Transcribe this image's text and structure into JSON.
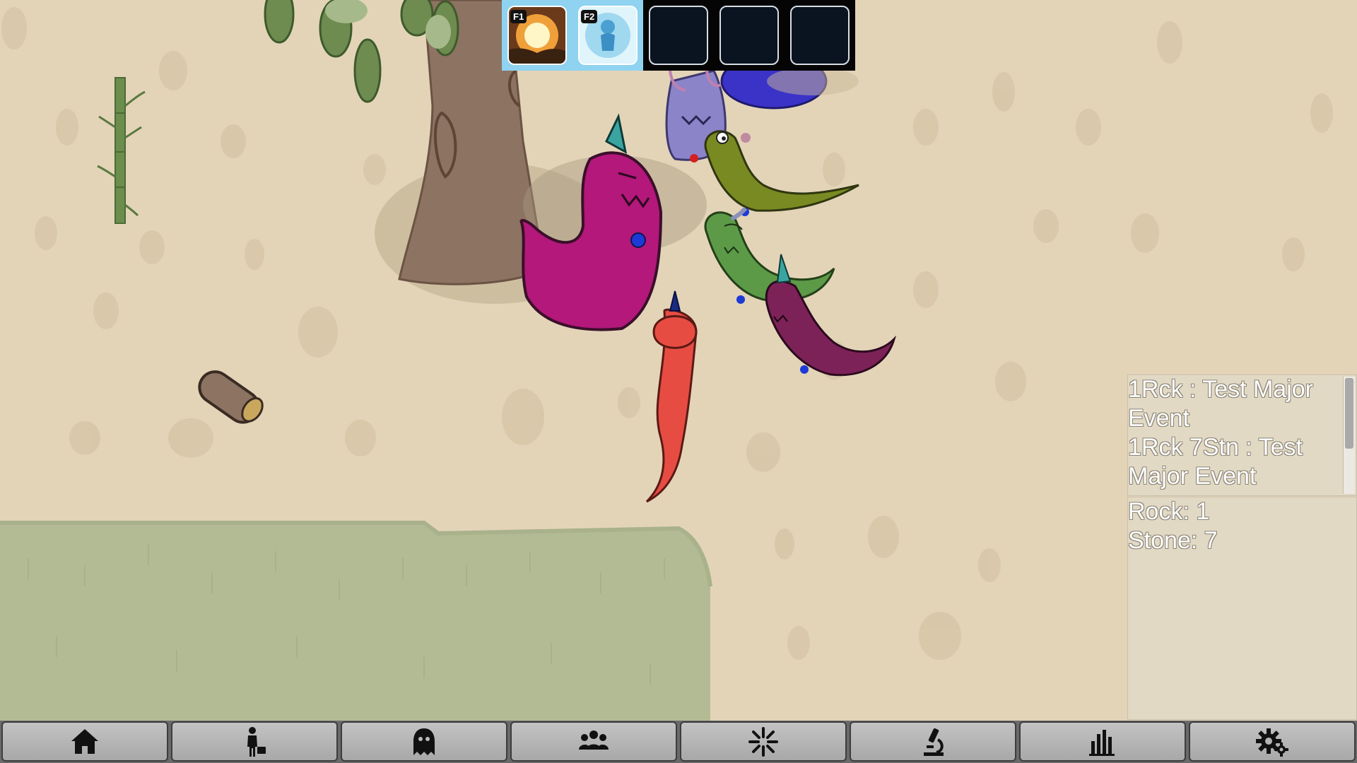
{
  "hotbar": {
    "slots": [
      {
        "key": "F1",
        "icon": "explosion-ability-icon",
        "filled": true
      },
      {
        "key": "F2",
        "icon": "frost-spirit-ability-icon",
        "filled": true
      },
      {
        "key": "",
        "icon": "empty-slot",
        "filled": false
      },
      {
        "key": "",
        "icon": "empty-slot",
        "filled": false
      },
      {
        "key": "",
        "icon": "empty-slot",
        "filled": false
      }
    ]
  },
  "log": {
    "lines": [
      "1Rck : Test Major",
      "Event",
      "1Rck 7Stn : Test",
      "Major Event"
    ]
  },
  "resources": {
    "rock": "Rock: 1",
    "stone": "Stone: 7"
  },
  "toolbar": {
    "buttons": [
      {
        "icon": "home-icon"
      },
      {
        "icon": "worker-icon"
      },
      {
        "icon": "ghost-icon"
      },
      {
        "icon": "group-icon"
      },
      {
        "icon": "burst-icon"
      },
      {
        "icon": "microscope-icon"
      },
      {
        "icon": "bar-chart-icon"
      },
      {
        "icon": "settings-gears-icon"
      }
    ]
  },
  "colors": {
    "ground": "#e3d4b8",
    "grass": "#b5bd95",
    "hotbar_bg": "#050505",
    "hotbar_active": "#8fd3f0",
    "toolbar_bg": "#6a6a6a"
  }
}
